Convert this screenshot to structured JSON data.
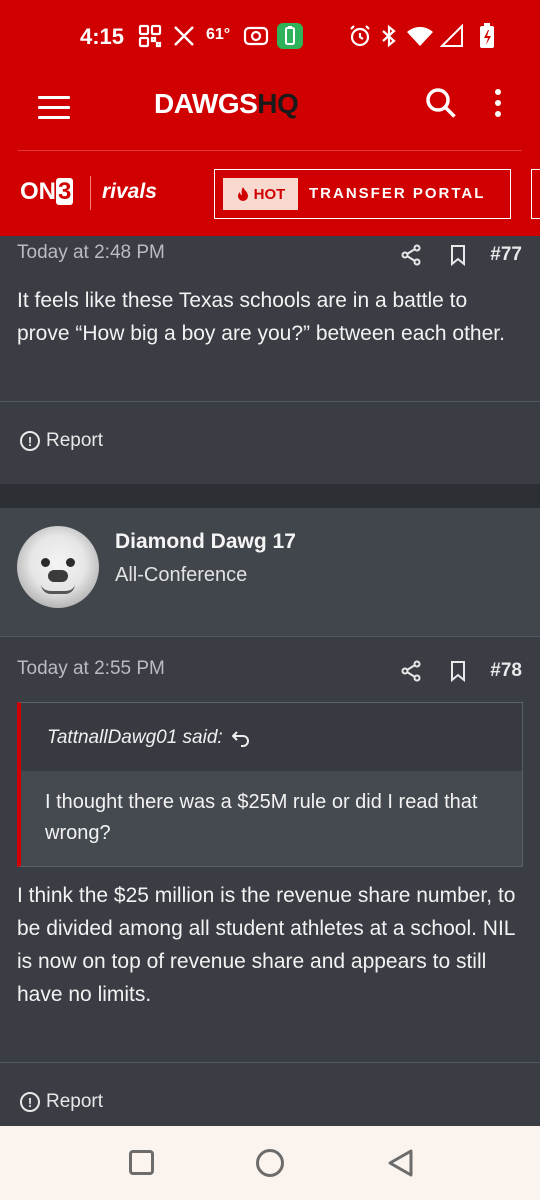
{
  "status_bar": {
    "time": "4:15",
    "temperature": "61°",
    "icons": [
      "qr-icon",
      "x-logo-icon",
      "radio-icon",
      "battery-saver-icon",
      "alarm-icon",
      "bluetooth-icon",
      "wifi-icon",
      "signal-icon",
      "battery-icon"
    ]
  },
  "header": {
    "logo_main": "DAWGS",
    "logo_hq": "HQ",
    "icons": [
      "menu-icon",
      "search-icon",
      "more-vertical-icon"
    ]
  },
  "subbar": {
    "on3_prefix": "ON",
    "on3_number": "3",
    "rivals": "rivals",
    "hot_badge": "HOT",
    "portal_label": "TRANSFER PORTAL"
  },
  "posts": [
    {
      "timestamp": "Today at 2:48 PM",
      "number": "#77",
      "body": "It feels like these Texas schools are in a battle to prove “How big a boy are you?” between each other.",
      "report_label": "Report"
    },
    {
      "author": "Diamond Dawg 17",
      "author_title": "All-Conference",
      "timestamp": "Today at 2:55 PM",
      "number": "#78",
      "quote_author": "TattnallDawg01 said:",
      "quote_text": "I thought there was a $25M rule or did I read that wrong?",
      "body": "I think the $25 million is the revenue share number, to be divided among all student athletes at a school. NIL is now on top of revenue share and appears to still have no limits.",
      "report_label": "Report"
    }
  ],
  "colors": {
    "brand_red": "#d10000",
    "background": "#3a3d43",
    "author_block": "#41454c",
    "navbar": "#fbf3ee"
  }
}
